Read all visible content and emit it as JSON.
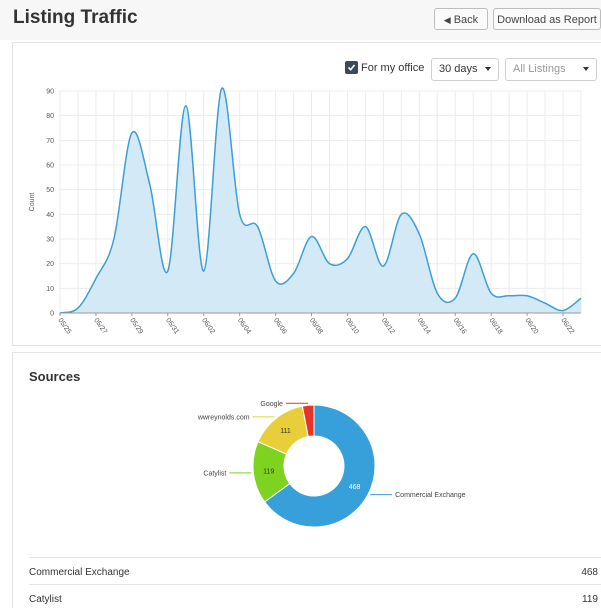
{
  "header": {
    "title": "Listing Traffic",
    "back_label": "Back",
    "download_label": "Download as Report"
  },
  "filters": {
    "office_checked": true,
    "office_label": "For my office",
    "days_value": "30 days",
    "listings_value": "All Listings"
  },
  "chart_data": {
    "type": "area",
    "ylabel": "Count",
    "ylim": [
      0,
      90
    ],
    "yticks": [
      0,
      10,
      20,
      30,
      40,
      50,
      60,
      70,
      80,
      90
    ],
    "grid": true,
    "x_tick_labels": [
      "05/25",
      "05/27",
      "05/29",
      "05/31",
      "06/02",
      "06/04",
      "06/06",
      "06/08",
      "06/10",
      "06/12",
      "06/14",
      "06/16",
      "06/18",
      "06/20",
      "06/22"
    ],
    "x_dates": [
      "05/25",
      "05/26",
      "05/27",
      "05/28",
      "05/29",
      "05/30",
      "05/31",
      "06/01",
      "06/02",
      "06/03",
      "06/04",
      "06/05",
      "06/06",
      "06/07",
      "06/08",
      "06/09",
      "06/10",
      "06/11",
      "06/12",
      "06/13",
      "06/14",
      "06/15",
      "06/16",
      "06/17",
      "06/18",
      "06/19",
      "06/20",
      "06/21",
      "06/22",
      "06/23"
    ],
    "y_values": [
      0,
      2,
      14,
      30,
      73,
      52,
      17,
      84,
      17,
      91,
      40,
      35,
      13,
      16,
      31,
      20,
      22,
      35,
      19,
      40,
      32,
      8,
      6,
      24,
      8,
      7,
      7,
      4,
      1,
      6
    ],
    "line_color": "#3a9fd6",
    "fill_color": "#d4e9f6"
  },
  "sources": {
    "title": "Sources",
    "chart_data": {
      "type": "pie",
      "labels": [
        "Commercial Exchange",
        "Catylist",
        "wwreynolds.com",
        "Google"
      ],
      "values": [
        468,
        119,
        111,
        22
      ],
      "value_labels": [
        "468",
        "119",
        "111",
        ""
      ],
      "colors": [
        "#37a0da",
        "#7ed321",
        "#e8cf3a",
        "#e5342a"
      ]
    },
    "rows": [
      {
        "name": "Commercial Exchange",
        "count": "468"
      },
      {
        "name": "Catylist",
        "count": "119"
      }
    ]
  }
}
